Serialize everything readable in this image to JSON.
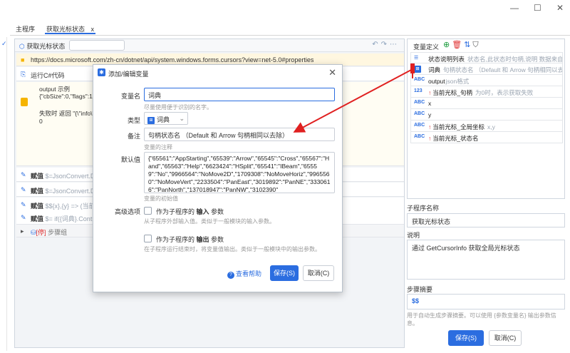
{
  "window": {
    "minimize": "—",
    "maximize": "☐",
    "close": "✕"
  },
  "tabs": [
    {
      "label": "主程序"
    },
    {
      "label": "获取光标状态",
      "close": "x"
    }
  ],
  "editor": {
    "title": "获取光标状态",
    "url_line": "https://docs.microsoft.com/zh-cn/dotnet/api/system.windows.forms.cursors?view=net-5.0#properties",
    "csharp_label": "运行C#代码",
    "code_lines": [
      "output 示例",
      "{\"cbSize\":0,\"flags\":1,\"hC",
      "",
      "失败时 返回 \"{\\\"info\\\":\\\"",
      "0"
    ],
    "assign_rows": [
      {
        "kw": "赋值",
        "expr": "$=JsonConvert.D"
      },
      {
        "kw": "赋值",
        "expr": "$=JsonConvert.D"
      },
      {
        "kw": "赋值",
        "expr": "$${x},{y} => (当前"
      },
      {
        "kw": "赋值",
        "expr": "$= if({词典}.Cont"
      }
    ],
    "group": {
      "tag": "[停]",
      "label": "步骤组"
    }
  },
  "variables": {
    "title": "变量定义",
    "items": [
      {
        "type": "list",
        "name": "状态说明列表",
        "desc": "状态名,此状态时句柄,说明 数据来自cy"
      },
      {
        "type": "dict",
        "name": "词典",
        "desc": "句柄状态名 （Default 和 Arrow 句柄相同以去"
      },
      {
        "type": "ABC",
        "name": "output",
        "desc": "json格式"
      },
      {
        "type": "123",
        "name": "当前光标_句柄",
        "desc": "为0时，表示获取失败",
        "out": true
      },
      {
        "type": "ABC",
        "name": "x",
        "desc": ""
      },
      {
        "type": "ABC",
        "name": "y",
        "desc": ""
      },
      {
        "type": "ABC",
        "name": "当前光标_全局坐标",
        "desc": "x,y",
        "out": true
      },
      {
        "type": "ABC",
        "name": "当前光标_状态名",
        "desc": "",
        "out": true
      }
    ]
  },
  "side": {
    "subname_label": "子程序名称",
    "subname_value": "获取光标状态",
    "desc_label": "说明",
    "desc_value": "通过 GetCursorInfo 获取全局光标状态",
    "summary_label": "步骤摘要",
    "summary_value": "$$",
    "summary_hint": "用于自动生成步骤摘要。可以使用 {参数变量名} 输出参数信息。",
    "save": "保存(S)",
    "cancel": "取消(C)"
  },
  "modal": {
    "title": "添加/编辑变量",
    "close": "✕",
    "name_label": "变量名",
    "name_value": "词典",
    "name_hint": "尽量使用便于识别的名字。",
    "type_label": "类型",
    "type_value": "词典",
    "note_label": "备注",
    "note_value": "句柄状态名 （Default 和 Arrow 句柄相同以去除）",
    "note_hint": "变量的注释",
    "default_label": "默认值",
    "default_value": "{\"65561\":\"AppStarting\",\"65539\":\"Arrow\",\"65545\":\"Cross\",\"65567\":\"Hand\",\"65563\":\"Help\",\"6623424\":\"HSplit\",\"65541\":\"IBeam\",\"65559\":\"No\",\"9966564\":\"NoMove2D\",\"1709308\":\"NoMoveHoriz\",\"9965560\":\"NoMoveVert\",\"2233504\":\"PanEast\",\"3019892\":\"PanNE\",\"3330616\":\"PanNorth\",\"137018947\":\"PanNW\",\"3102390\"",
    "default_hint": "变量的初始值",
    "advanced_label": "高级选项",
    "input_check_pre": "作为子程序的 ",
    "input_check_bold": "输入",
    "input_check_post": " 参数",
    "input_hint": "从子程序外部输入值。类似于一般模块的输入参数。",
    "output_check_pre": "作为子程序的 ",
    "output_check_bold": "输出",
    "output_check_post": " 参数",
    "output_hint": "在子程序运行结束时，将变量值输出。类似于一般模块中的输出参数。",
    "help": "查看帮助",
    "save": "保存(S)",
    "cancel": "取消(C)"
  },
  "colors": {
    "accent": "#2b6de0",
    "arrow": "#e02020"
  }
}
